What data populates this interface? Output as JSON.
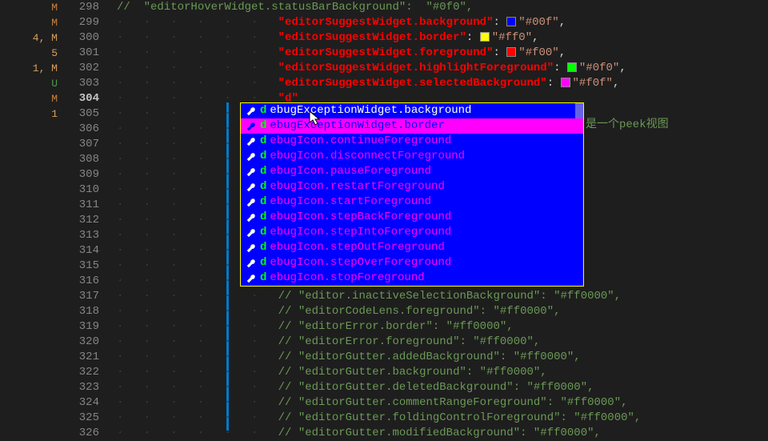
{
  "gutter_marks": [
    "",
    "M",
    "",
    "",
    "",
    "",
    "",
    "M",
    "",
    "",
    "",
    "",
    "",
    "4, M",
    "5",
    "1, M",
    "",
    "",
    "",
    "",
    "",
    "U",
    "",
    "",
    "M",
    "",
    "",
    "",
    "",
    "1",
    ""
  ],
  "line_numbers": [
    "298",
    "299",
    "300",
    "301",
    "302",
    "303",
    "304",
    "305",
    "306",
    "307",
    "308",
    "309",
    "310",
    "311",
    "312",
    "313",
    "314",
    "315",
    "316",
    "317",
    "318",
    "319",
    "320",
    "321",
    "322",
    "323",
    "324",
    "325",
    "326"
  ],
  "current_line_idx": 6,
  "code": {
    "l298": {
      "prefix": "// \"editorHoverWidget.statusBarBackground\":",
      "hex": "#0f0"
    },
    "l299": {
      "indent": "                ",
      "key": "editorSuggestWidget.background",
      "hex": "#00f"
    },
    "l300": {
      "indent": "                ",
      "key": "editorSuggestWidget.border",
      "hex": "#ff0"
    },
    "l301": {
      "indent": "                ",
      "key": "editorSuggestWidget.foreground",
      "hex": "#f00"
    },
    "l302": {
      "indent": "                ",
      "key": "editorSuggestWidget.highlightForeground",
      "hex": "#0f0"
    },
    "l303": {
      "indent": "                ",
      "key": "editorSuggestWidget.selectedBackground",
      "hex": "#f0f"
    },
    "l304": {
      "indent": "                ",
      "typed": "\"d\""
    },
    "l305": {
      "indent": "                ",
      "text": "/*"
    },
    "l306": {
      "indent": "                ",
      "text": "// "
    },
    "annotation": "是一个peek视图",
    "generic_indented": "// ",
    "l317": "// \"editor.inactiveSelectionBackground\": \"#ff0000\",",
    "l318": "// \"editorCodeLens.foreground\": \"#ff0000\",",
    "l319": "// \"editorError.border\": \"#ff0000\",",
    "l320": "// \"editorError.foreground\": \"#ff0000\",",
    "l321": "// \"editorGutter.addedBackground\": \"#ff0000\",",
    "l322": "// \"editorGutter.background\": \"#ff0000\",",
    "l323": "// \"editorGutter.deletedBackground\": \"#ff0000\",",
    "l324": "// \"editorGutter.commentRangeForeground\": \"#ff0000\",",
    "l325": "// \"editorGutter.foldingControlForeground\": \"#ff0000\",",
    "l326": "// \"editorGutter.modifiedBackground\": \"#ff0000\","
  },
  "suggest_items": [
    {
      "hl": "d",
      "rest": "ebugExceptionWidget.background",
      "focus": "top"
    },
    {
      "hl": "d",
      "rest": "ebugExceptionWidget.border",
      "focus": "selected"
    },
    {
      "hl": "d",
      "rest": "ebugIcon.continueForeground"
    },
    {
      "hl": "d",
      "rest": "ebugIcon.disconnectForeground"
    },
    {
      "hl": "d",
      "rest": "ebugIcon.pauseForeground"
    },
    {
      "hl": "d",
      "rest": "ebugIcon.restartForeground"
    },
    {
      "hl": "d",
      "rest": "ebugIcon.startForeground"
    },
    {
      "hl": "d",
      "rest": "ebugIcon.stepBackForeground"
    },
    {
      "hl": "d",
      "rest": "ebugIcon.stepIntoForeground"
    },
    {
      "hl": "d",
      "rest": "ebugIcon.stepOutForeground"
    },
    {
      "hl": "d",
      "rest": "ebugIcon.stepOverForeground"
    },
    {
      "hl": "d",
      "rest": "ebugIcon.stopForeground"
    }
  ],
  "colors": {
    "c299": "#0000ff",
    "c300": "#ffff00",
    "c301": "#ff0000",
    "c302": "#00ff00",
    "c303": "#ff00ff"
  }
}
